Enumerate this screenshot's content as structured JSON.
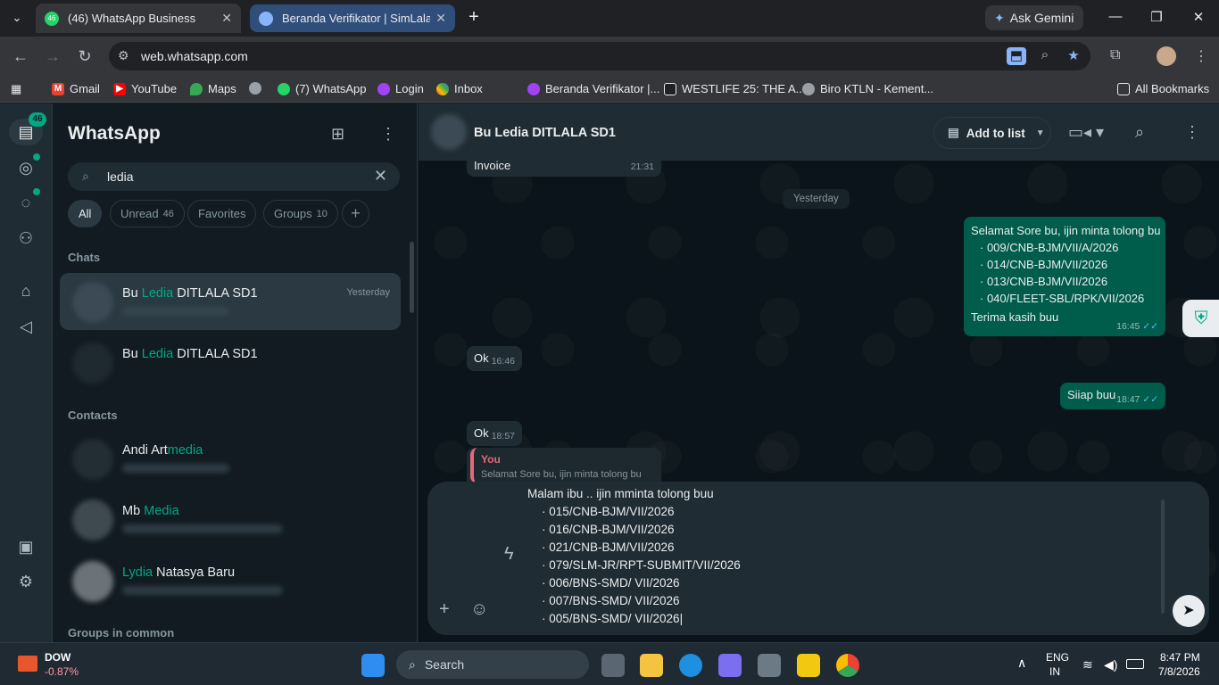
{
  "browser": {
    "tabs": [
      {
        "title": "(46) WhatsApp Business",
        "badge": "46"
      },
      {
        "title": "Beranda Verifikator | SimLala"
      }
    ],
    "gemini_label": "Ask Gemini",
    "url": "web.whatsapp.com",
    "bookmarks": [
      "Gmail",
      "YouTube",
      "Maps",
      "(7) WhatsApp",
      "Login",
      "Inbox",
      "Beranda Verifikator |...",
      "WESTLIFE 25: THE A...",
      "Biro KTLN - Kement..."
    ],
    "all_bookmarks": "All Bookmarks"
  },
  "rail": {
    "chats_badge": "46"
  },
  "sidebar": {
    "title": "WhatsApp",
    "search_value": "ledia",
    "filters": [
      {
        "label": "All",
        "count": ""
      },
      {
        "label": "Unread",
        "count": "46"
      },
      {
        "label": "Favorites",
        "count": ""
      },
      {
        "label": "Groups",
        "count": "10"
      }
    ],
    "chats_header": "Chats",
    "chats": [
      {
        "pre": "Bu ",
        "hl": "Ledia",
        "post": " DITLALA SD1",
        "time": "Yesterday"
      },
      {
        "pre": "Bu ",
        "hl": "Ledia",
        "post": " DITLALA SD1",
        "time": ""
      }
    ],
    "contacts_header": "Contacts",
    "contacts": [
      {
        "pre": "Andi Art",
        "hl": "media",
        "post": ""
      },
      {
        "pre": "Mb ",
        "hl": "Media",
        "post": ""
      },
      {
        "pre": "",
        "hl": "Lydia",
        "post": " Natasya Baru"
      }
    ],
    "groups_header": "Groups in common"
  },
  "conversation": {
    "name": "Bu Ledia DITLALA SD1",
    "add_to_list": "Add to list",
    "messages": {
      "invoice": {
        "text": "Invoice",
        "time": "21:31"
      },
      "day_label": "Yesterday",
      "out1": {
        "greeting": "Selamat Sore bu, ijin minta tolong bu",
        "items": [
          "009/CNB-BJM/VII/A/2026",
          "014/CNB-BJM/VII/2026",
          "013/CNB-BJM/VII/2026",
          "040/FLEET-SBL/RPK/VII/2026"
        ],
        "closing": "Terima kasih buu",
        "time": "16:45"
      },
      "in_ok1": {
        "text": "Ok",
        "time": "16:46"
      },
      "out2": {
        "text": "Siiap buu",
        "time": "18:47"
      },
      "in_ok2": {
        "text": "Ok",
        "time": "18:57"
      },
      "reply": {
        "who": "You",
        "text": "Selamat Sore bu, ijin minta tolong bu"
      }
    },
    "composer": {
      "first_line": "Malam ibu .. ijin mminta tolong buu",
      "items": [
        "015/CNB-BJM/VII/2026",
        "016/CNB-BJM/VII/2026",
        "021/CNB-BJM/VII/2026",
        "079/SLM-JR/RPT-SUBMIT/VII/2026",
        "006/BNS-SMD/ VII/2026",
        "007/BNS-SMD/ VII/2026",
        "005/BNS-SMD/ VII/2026"
      ]
    }
  },
  "taskbar": {
    "stock_name": "DOW",
    "stock_change": "-0.87%",
    "search_label": "Search",
    "lang": "ENG",
    "region": "IN",
    "time": "8:47 PM",
    "date": "7/8/2026"
  },
  "colors": {
    "accent": "#00a884",
    "outgoing": "#005c4b",
    "incoming": "#202c33"
  }
}
